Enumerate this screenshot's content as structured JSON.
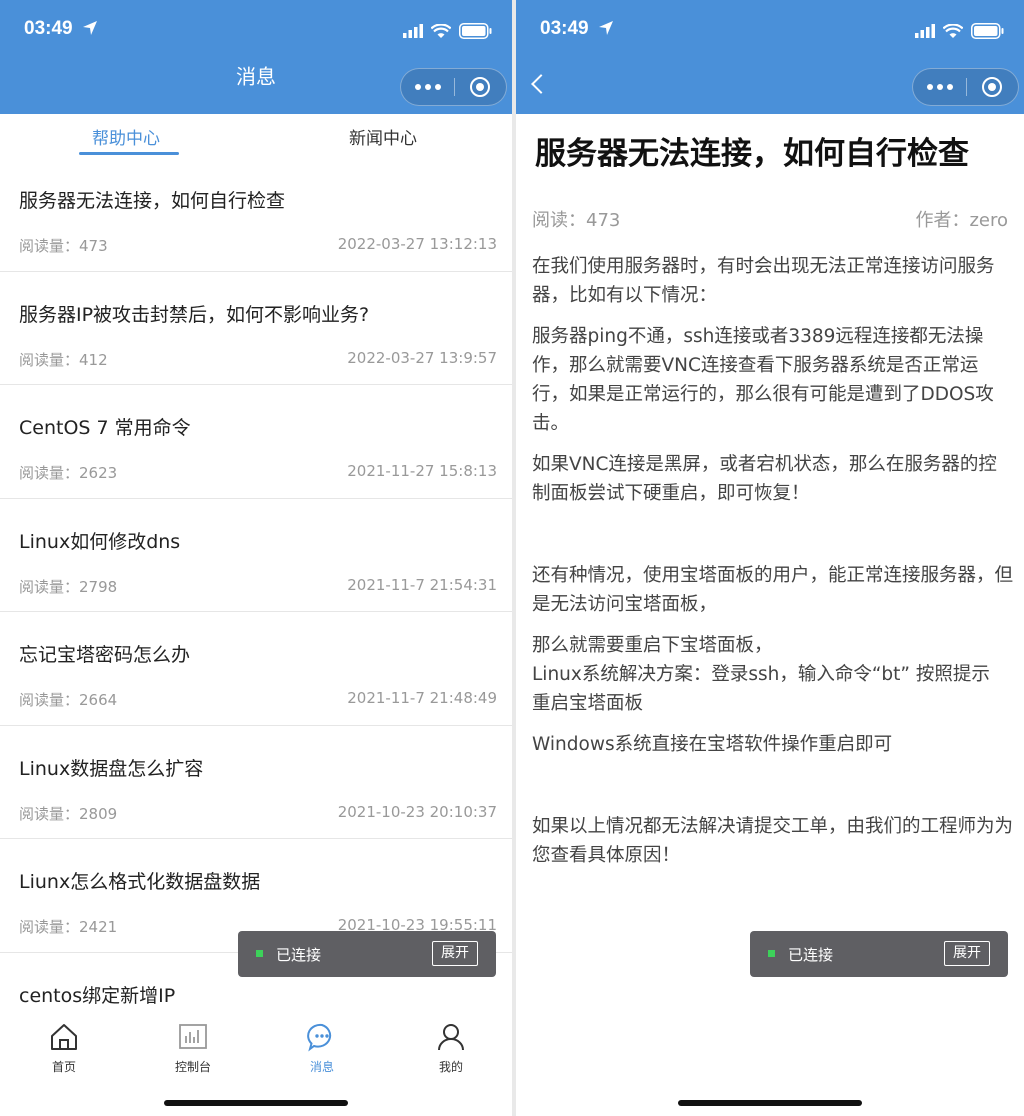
{
  "status_time": "03:49",
  "left": {
    "nav_title": "消息",
    "tabs": [
      "帮助中心",
      "新闻中心"
    ],
    "articles": [
      {
        "title": "服务器无法连接，如何自行检查",
        "reads": "阅读量：473",
        "date": "2022-03-27 13:12:13"
      },
      {
        "title": "服务器IP被攻击封禁后，如何不影响业务?",
        "reads": "阅读量：412",
        "date": "2022-03-27 13:9:57"
      },
      {
        "title": "CentOS 7 常用命令",
        "reads": "阅读量：2623",
        "date": "2021-11-27 15:8:13"
      },
      {
        "title": "Linux如何修改dns",
        "reads": "阅读量：2798",
        "date": "2021-11-7 21:54:31"
      },
      {
        "title": "忘记宝塔密码怎么办",
        "reads": "阅读量：2664",
        "date": "2021-11-7 21:48:49"
      },
      {
        "title": "Linux数据盘怎么扩容",
        "reads": "阅读量：2809",
        "date": "2021-10-23 20:10:37"
      },
      {
        "title": "Liunx怎么格式化数据盘数据",
        "reads": "阅读量：2421",
        "date": "2021-10-23 19:55:11"
      },
      {
        "title": "centos绑定新增IP",
        "reads": "",
        "date": ""
      }
    ],
    "toast": {
      "label": "已连接",
      "button": "展开"
    },
    "tabbar": [
      {
        "label": "首页",
        "icon": "home-icon"
      },
      {
        "label": "控制台",
        "icon": "chart-icon"
      },
      {
        "label": "消息",
        "icon": "message-icon"
      },
      {
        "label": "我的",
        "icon": "user-icon"
      }
    ]
  },
  "right": {
    "title": "服务器无法连接，如何自行检查",
    "reads": "阅读：473",
    "author": "作者：zero",
    "paragraphs": [
      "在我们使用服务器时，有时会出现无法正常连接访问服务器，比如有以下情况：",
      "服务器ping不通，ssh连接或者3389远程连接都无法操作，那么就需要VNC连接查看下服务器系统是否正常运行，如果是正常运行的，那么很有可能是遭到了DDOS攻击。",
      "如果VNC连接是黑屏，或者宕机状态，那么在服务器的控制面板尝试下硬重启，即可恢复！",
      "还有种情况，使用宝塔面板的用户，能正常连接服务器，但是无法访问宝塔面板，",
      "那么就需要重启下宝塔面板，",
      "Linux系统解决方案：登录ssh，输入命令“bt” 按照提示 重启宝塔面板",
      "Windows系统直接在宝塔软件操作重启即可",
      "如果以上情况都无法解决请提交工单，由我们的工程师为为您查看具体原因！"
    ],
    "toast": {
      "label": "已连接",
      "button": "展开"
    }
  },
  "colors": {
    "accent": "#4a90d9",
    "toast_bg": "#5f5f63",
    "online_dot": "#3dd15a"
  }
}
